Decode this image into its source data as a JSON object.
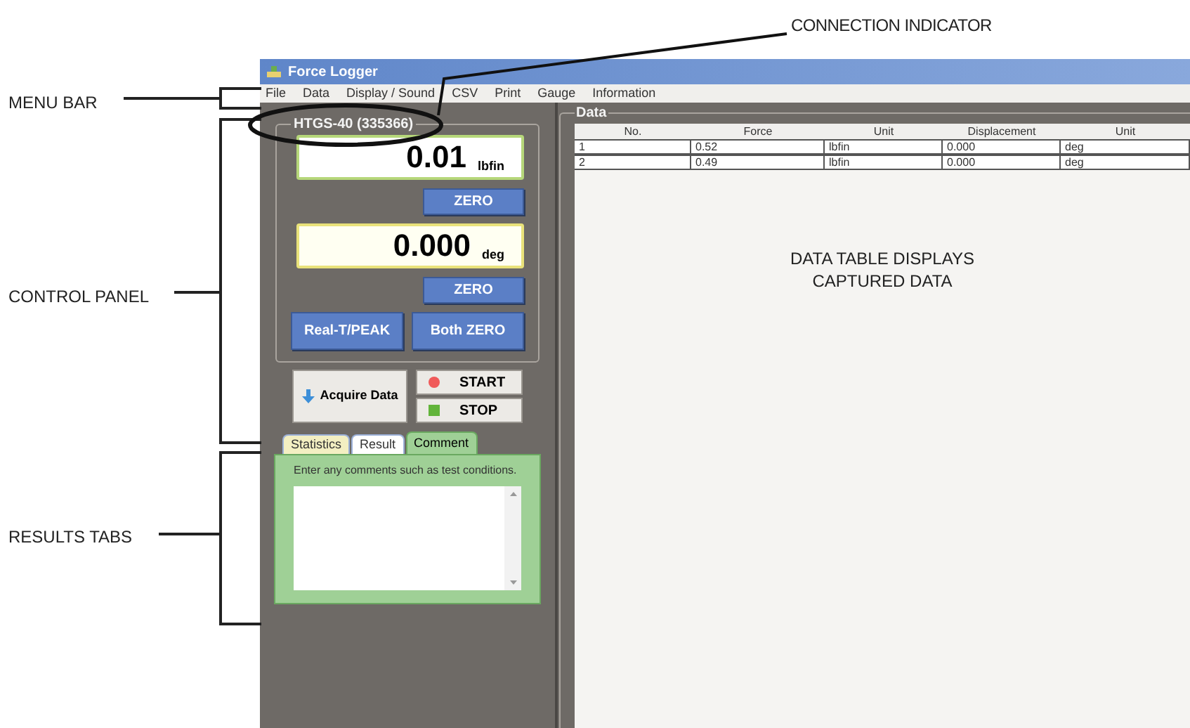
{
  "window": {
    "title": "Force Logger"
  },
  "menu_bar": [
    "File",
    "Data",
    "Display / Sound",
    "CSV",
    "Print",
    "Gauge",
    "Information"
  ],
  "connection": {
    "label": "HTGS-40 (335366)"
  },
  "displays": [
    {
      "kind": "force",
      "value": "0.01",
      "unit": "lbfin",
      "zero_label": "ZERO"
    },
    {
      "kind": "displacement",
      "value": "0.000",
      "unit": "deg",
      "zero_label": "ZERO"
    }
  ],
  "mode_buttons": [
    "Real-T/PEAK",
    "Both ZERO"
  ],
  "acquire_button": "Acquire Data",
  "start_button": "START",
  "stop_button": "STOP",
  "result_tabs": [
    {
      "label": "Statistics",
      "selected": false,
      "color": "#f3efc2"
    },
    {
      "label": "Result",
      "selected": false,
      "color": "#ffffff"
    },
    {
      "label": "Comment",
      "selected": true,
      "color": "#9fd096"
    }
  ],
  "comment_panel": {
    "hint": "Enter any comments such as test conditions."
  },
  "data_panel": {
    "title": "Data",
    "columns": [
      "No.",
      "Force",
      "Unit",
      "Displacement",
      "Unit"
    ],
    "rows": [
      [
        "1",
        "0.52",
        "lbfin",
        "0.000",
        "deg"
      ],
      [
        "2",
        "0.49",
        "lbfin",
        "0.000",
        "deg"
      ]
    ]
  },
  "annotations": {
    "connection_indicator": "CONNECTION INDICATOR",
    "menu_bar": "MENU BAR",
    "control_panel": "CONTROL PANEL",
    "results_tabs": "RESULTS TABS",
    "data_table": "DATA TABLE DISPLAYS CAPTURED DATA"
  }
}
